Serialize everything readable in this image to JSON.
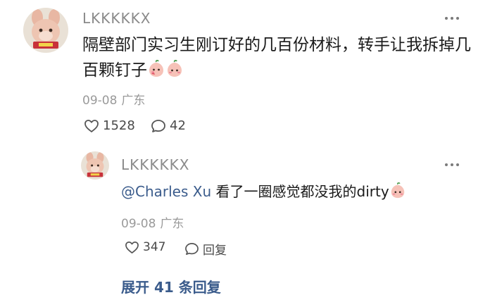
{
  "comment": {
    "username": "LKKKKKX",
    "text_line1": "隔壁部门实习生刚订好的几百份材料，转手让我拆掉几",
    "text_line2": "百颗钉子",
    "date": "09-08",
    "location": "广东",
    "likes": "1528",
    "replies": "42"
  },
  "reply": {
    "username": "LKKKKKX",
    "mention": "@Charles Xu",
    "text": " 看了一圈感觉都没我的dirty",
    "date": "09-08",
    "location": "广东",
    "likes": "347",
    "reply_label": "回复"
  },
  "expand_label": "展开 41 条回复",
  "icons": {
    "more": "more-dots-icon",
    "like": "heart-icon",
    "comment": "speech-bubble-icon",
    "emoji": "peach-emoji-icon"
  },
  "colors": {
    "link": "#3b5c8c",
    "meta": "#9a9a9a",
    "username": "#8a8a8a"
  }
}
